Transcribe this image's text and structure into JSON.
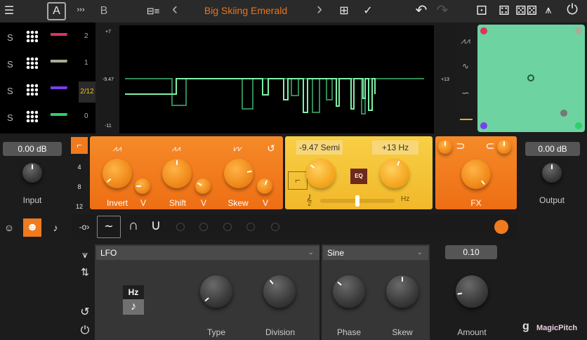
{
  "topbar": {
    "menu_icon": "hamburger-icon",
    "slot_a": "A",
    "copy_icon": "copy-arrows-icon",
    "slot_b": "B",
    "preset_list_icon": "preset-list-icon",
    "prev": "‹",
    "preset_name": "Big Skiing Emerald",
    "next": "›",
    "add_preset_icon": "add-preset-icon",
    "save_preset_icon": "save-preset-icon",
    "undo": "↶",
    "redo": "↷",
    "icons": [
      "dice-one-icon",
      "dice-four-icon",
      "dice-double-icon",
      "routing-icon",
      "power-icon"
    ]
  },
  "voices": [
    {
      "solo": "S",
      "number": "2",
      "color": "#e0325a"
    },
    {
      "solo": "S",
      "number": "1",
      "color": "#a9ad96"
    },
    {
      "solo": "S",
      "number": "",
      "color": "#7b3ff0",
      "badge": "2/12"
    },
    {
      "solo": "S",
      "number": "0",
      "color": "#2fcf6e"
    }
  ],
  "scale": {
    "top": "+7",
    "mid": "-9.47",
    "bottom": "-11"
  },
  "right_scale": {
    "value": "+13"
  },
  "waveform_icons": [
    "square-wave-icon",
    "triangle-wave-icon",
    "sine-wave-icon",
    "flat-line-icon"
  ],
  "xy_pad": {
    "background": "#6dd3a0",
    "corners": [
      "#e0325a",
      "#a9ad96",
      "#7b3ff0",
      "#2fcf6e"
    ]
  },
  "input": {
    "value": "0.00 dB",
    "label": "Input"
  },
  "output": {
    "value": "0.00 dB",
    "label": "Output"
  },
  "grid_options": [
    "4",
    "8",
    "12"
  ],
  "shape_panel": {
    "knobs": [
      {
        "label": "Invert",
        "caret": "V"
      },
      {
        "label": "Shift",
        "caret": "V"
      },
      {
        "label": "Skew",
        "caret": "V"
      }
    ]
  },
  "pitch_panel": {
    "semi": "-9.47 Semi",
    "hz": "+13 Hz",
    "eq": "EQ",
    "clef": "𝄞",
    "slider_unit": "Hz",
    "slider_value": 0.5
  },
  "fx_panel": {
    "label": "FX"
  },
  "mod": {
    "lfo_type": "LFO",
    "shape": "Sine",
    "amount": "0.10",
    "hz_button": "Hz",
    "note_button": "♪",
    "knobs": [
      "Type",
      "Division",
      "Phase",
      "Skew",
      "Amount"
    ]
  },
  "brand": {
    "logo": "g",
    "name": "MagicPitch"
  }
}
